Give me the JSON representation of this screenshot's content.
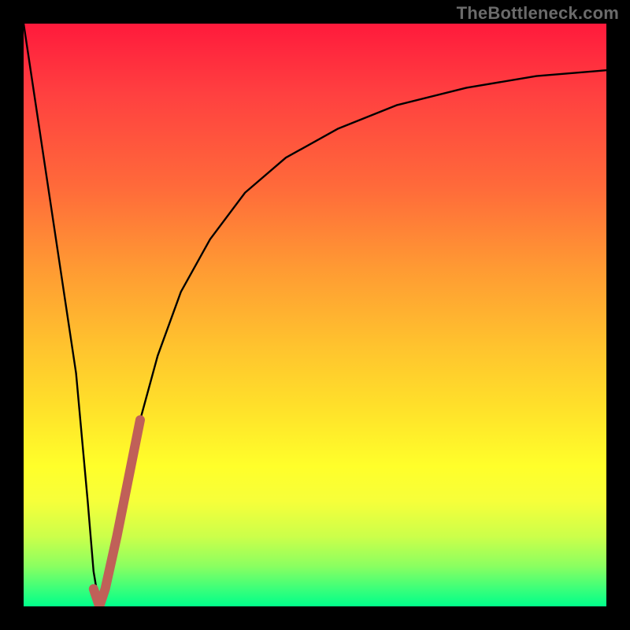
{
  "watermark": "TheBottleneck.com",
  "chart_data": {
    "type": "line",
    "title": "",
    "xlabel": "",
    "ylabel": "",
    "xlim": [
      0,
      100
    ],
    "ylim": [
      0,
      100
    ],
    "grid": false,
    "legend": false,
    "gradient_stops": [
      {
        "pos": 0,
        "color": "#ff1a3c"
      },
      {
        "pos": 12,
        "color": "#ff4040"
      },
      {
        "pos": 28,
        "color": "#ff6a3a"
      },
      {
        "pos": 42,
        "color": "#ff9a33"
      },
      {
        "pos": 55,
        "color": "#ffc22e"
      },
      {
        "pos": 66,
        "color": "#ffe12a"
      },
      {
        "pos": 76,
        "color": "#ffff2a"
      },
      {
        "pos": 82,
        "color": "#f6ff3a"
      },
      {
        "pos": 88,
        "color": "#ccff4a"
      },
      {
        "pos": 93,
        "color": "#8cff60"
      },
      {
        "pos": 97,
        "color": "#3bff7a"
      },
      {
        "pos": 100,
        "color": "#00ff8a"
      }
    ],
    "series": [
      {
        "name": "bottleneck_curve",
        "color": "#000000",
        "width": 2.4,
        "x": [
          0,
          3,
          6,
          9,
          11,
          12,
          13,
          14,
          16,
          18,
          20,
          23,
          27,
          32,
          38,
          45,
          54,
          64,
          76,
          88,
          100
        ],
        "y": [
          100,
          80,
          60,
          40,
          18,
          6,
          0,
          3,
          12,
          22,
          32,
          43,
          54,
          63,
          71,
          77,
          82,
          86,
          89,
          91,
          92
        ]
      },
      {
        "name": "highlight_segment",
        "color": "#c06058",
        "width": 12,
        "x": [
          12,
          13,
          14,
          16,
          18,
          20
        ],
        "y": [
          3,
          0,
          3,
          12,
          22,
          32
        ]
      }
    ]
  }
}
